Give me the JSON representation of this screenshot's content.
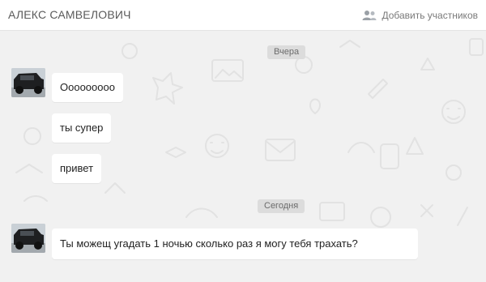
{
  "header": {
    "chat_title": "АЛЕКС САМВЕЛОВИЧ",
    "add_members_label": "Добавить участников",
    "add_members_icon": "people-icon"
  },
  "dates": {
    "yesterday": "Вчера",
    "today": "Сегодня"
  },
  "messages": [
    {
      "text": "Ооооооооо",
      "day": "yesterday"
    },
    {
      "text": "ты супер",
      "day": "yesterday"
    },
    {
      "text": "привет",
      "day": "yesterday"
    },
    {
      "text": "Ты можещ угадать 1 ночью сколько раз я могу тебя трахать?",
      "day": "today"
    }
  ],
  "colors": {
    "chat_background": "#f1f1f1",
    "bubble": "#ffffff",
    "date_pill": "#dcdcdc",
    "header_text": "#5a5a5a"
  }
}
